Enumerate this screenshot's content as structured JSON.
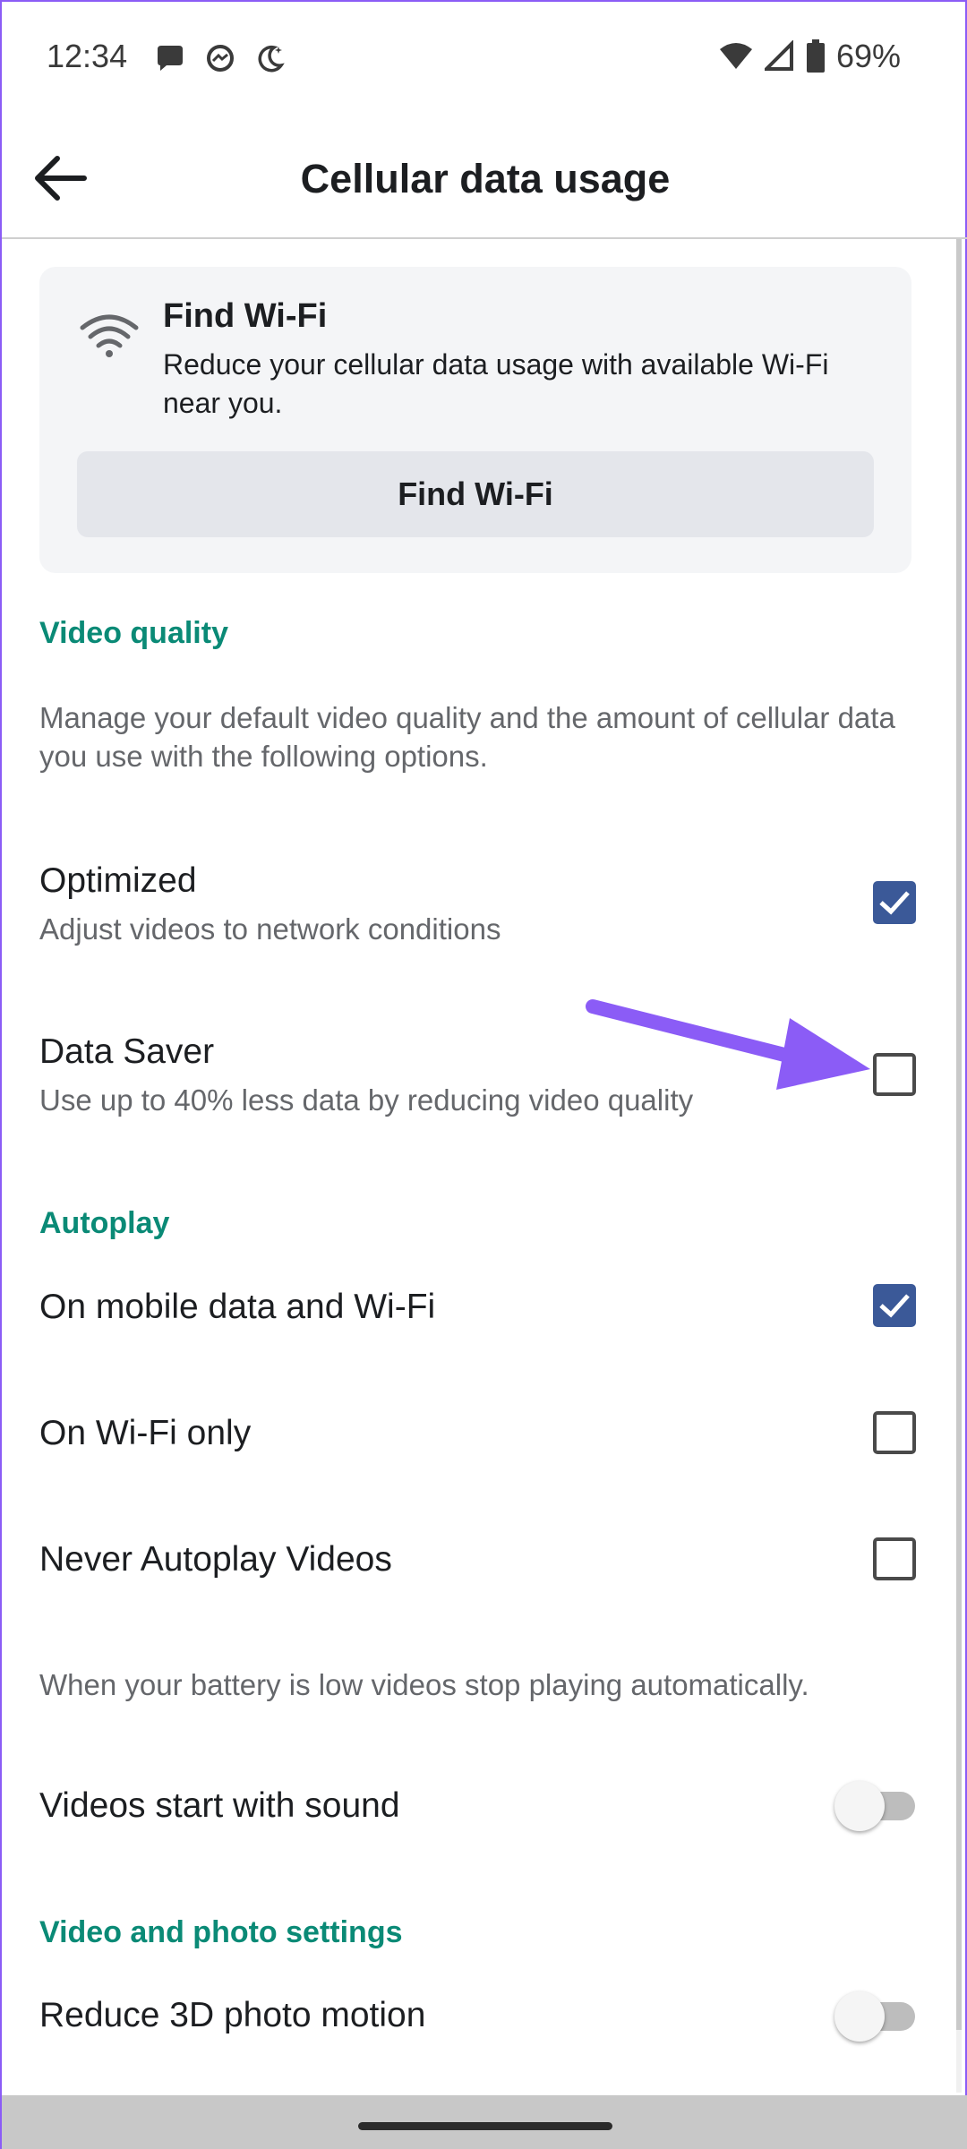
{
  "status_bar": {
    "time": "12:34",
    "battery": "69%",
    "left_icons": [
      "message-bubble-icon",
      "messenger-icon",
      "night-mode-icon"
    ],
    "right_icons": [
      "wifi-icon",
      "signal-icon",
      "battery-icon"
    ]
  },
  "header": {
    "title": "Cellular data usage",
    "back_icon": "arrow-left-icon"
  },
  "wifi_card": {
    "title": "Find Wi-Fi",
    "description": "Reduce your cellular data usage with available Wi-Fi near you.",
    "button_label": "Find Wi-Fi",
    "icon": "wifi-icon"
  },
  "video_quality": {
    "header": "Video quality",
    "description": "Manage your default video quality and the amount of cellular data you use with the following options.",
    "options": [
      {
        "title": "Optimized",
        "subtitle": "Adjust videos to network conditions",
        "checked": true
      },
      {
        "title": "Data Saver",
        "subtitle": "Use up to 40% less data by reducing video quality",
        "checked": false
      }
    ]
  },
  "autoplay": {
    "header": "Autoplay",
    "options": [
      {
        "title": "On mobile data and Wi-Fi",
        "checked": true
      },
      {
        "title": "On Wi-Fi only",
        "checked": false
      },
      {
        "title": "Never Autoplay Videos",
        "checked": false
      }
    ],
    "battery_note": "When your battery is low videos stop playing automatically.",
    "sound_toggle": {
      "label": "Videos start with sound",
      "on": false
    }
  },
  "video_photo_settings": {
    "header": "Video and photo settings",
    "motion_toggle": {
      "label": "Reduce 3D photo motion",
      "on": false
    }
  },
  "colors": {
    "accent_green": "#0a8a76",
    "checkbox_blue": "#3b5998",
    "annotation_purple": "#8b5cf6"
  }
}
